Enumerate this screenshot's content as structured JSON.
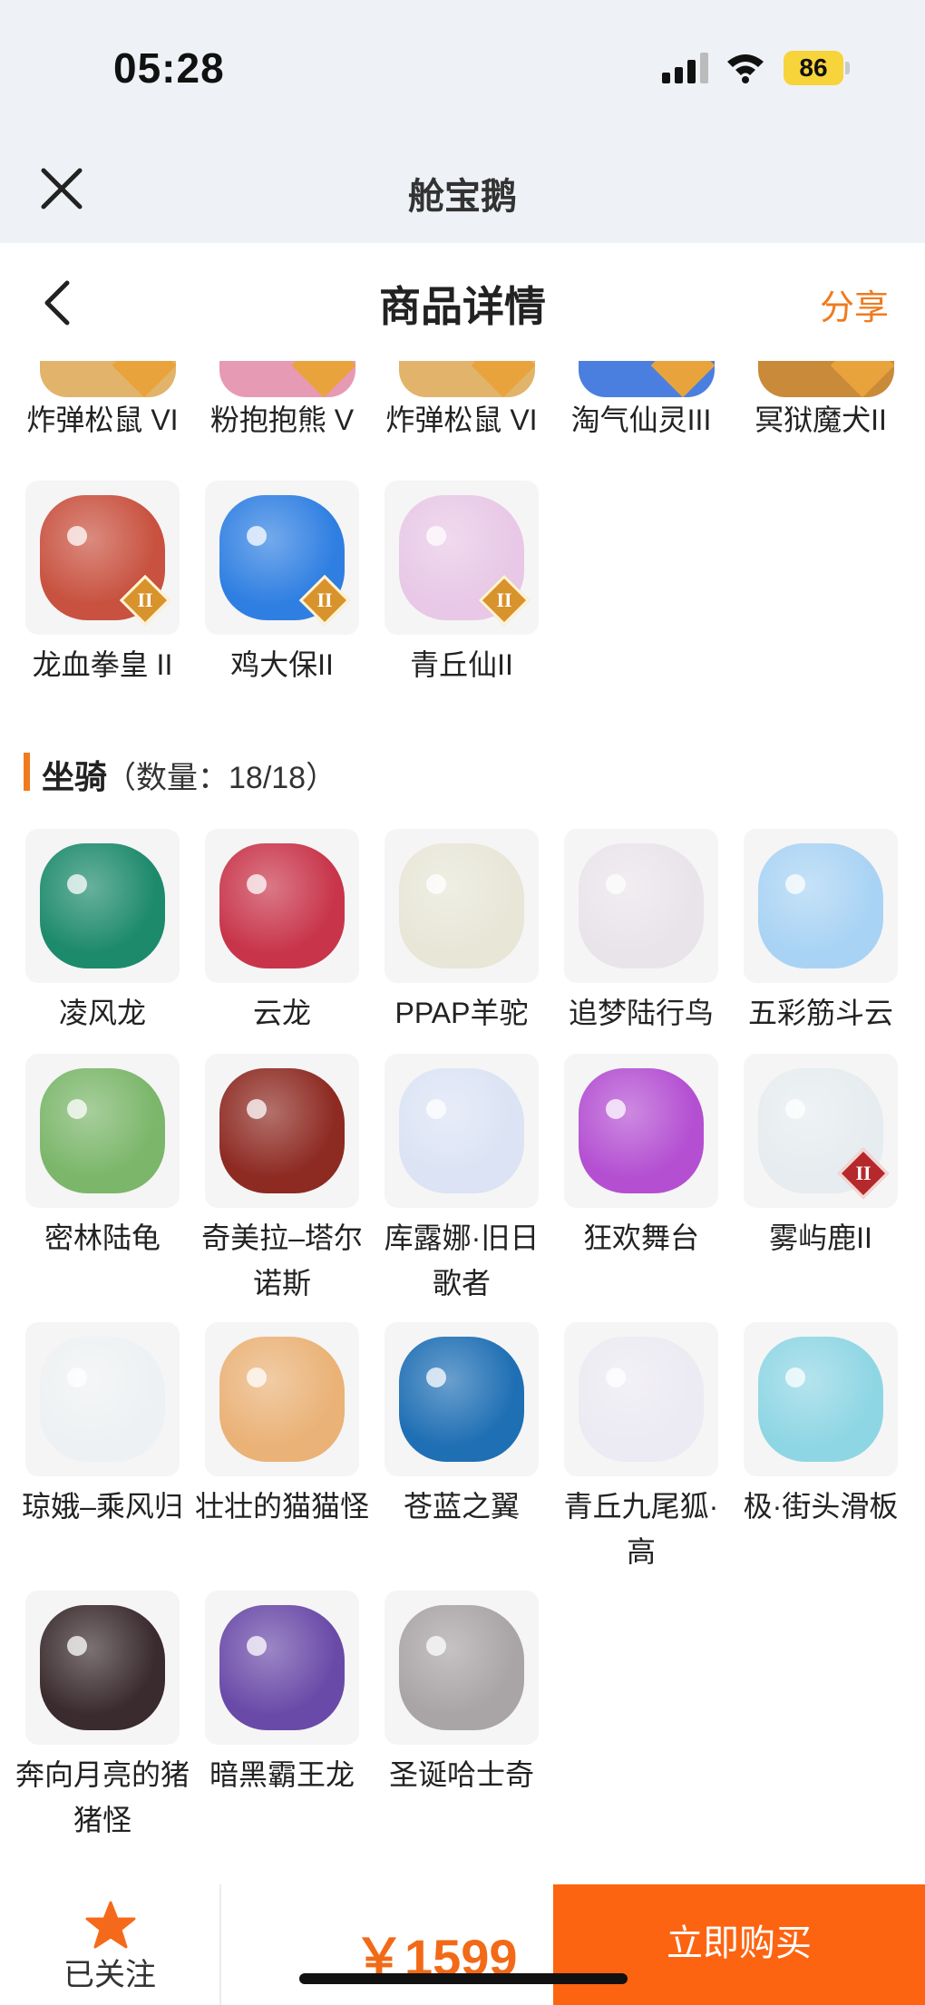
{
  "status": {
    "time": "05:28",
    "battery": "86"
  },
  "mini_program": {
    "title": "舱宝鹅"
  },
  "page": {
    "title": "商品详情",
    "share": "分享"
  },
  "cut_row": [
    {
      "label": "炸弹松鼠 VI",
      "color": "#e2b36a"
    },
    {
      "label": "粉抱抱熊 V",
      "color": "#e69ab3"
    },
    {
      "label": "炸弹松鼠 VI",
      "color": "#e2b36a"
    },
    {
      "label": "淘气仙灵III",
      "color": "#4a7fe0"
    },
    {
      "label": "冥狱魔犬II",
      "color": "#c98a3a"
    }
  ],
  "cut_grid": [
    {
      "label": "龙血拳皇 II",
      "rank": "II",
      "color": "#c8513f",
      "icon": "dragon-boxer-icon"
    },
    {
      "label": "鸡大保II",
      "rank": "II",
      "color": "#2f7fe2",
      "icon": "chicken-icon"
    },
    {
      "label": "青丘仙II",
      "rank": "II",
      "color": "#e8c8e6",
      "icon": "fox-fairy-icon"
    }
  ],
  "mounts_section": {
    "title": "坐骑",
    "count": "（数量：18/18）"
  },
  "mounts": [
    {
      "label": "凌风龙",
      "color": "#1d8a6b",
      "rank": ""
    },
    {
      "label": "云龙",
      "color": "#c8354a",
      "rank": ""
    },
    {
      "label": "PPAP羊驼",
      "color": "#e7e6d7",
      "rank": ""
    },
    {
      "label": "追梦陆行鸟",
      "color": "#e9e4ea",
      "rank": ""
    },
    {
      "label": "五彩筋斗云",
      "color": "#a9d3f4",
      "rank": ""
    },
    {
      "label": "密林陆龟",
      "color": "#7bb66a",
      "rank": ""
    },
    {
      "label": "奇美拉–塔尔诺斯",
      "color": "#8d2a22",
      "rank": ""
    },
    {
      "label": "库露娜·旧日歌者",
      "color": "#dbe3f4",
      "rank": ""
    },
    {
      "label": "狂欢舞台",
      "color": "#b44fd2",
      "rank": ""
    },
    {
      "label": "雾屿鹿II",
      "color": "#e6ecef",
      "rank": "II"
    },
    {
      "label": "琼娥–乘风归",
      "color": "#eef1f3",
      "rank": ""
    },
    {
      "label": "壮壮的猫猫怪",
      "color": "#eab277",
      "rank": ""
    },
    {
      "label": "苍蓝之翼",
      "color": "#1f6fb4",
      "rank": ""
    },
    {
      "label": "青丘九尾狐·高",
      "color": "#eceaf2",
      "rank": ""
    },
    {
      "label": "极·街头滑板",
      "color": "#8fd6e4",
      "rank": ""
    },
    {
      "label": "奔向月亮的猪猪怪",
      "color": "#3a2b2e",
      "rank": ""
    },
    {
      "label": "暗黑霸王龙",
      "color": "#6a4aa8",
      "rank": ""
    },
    {
      "label": "圣诞哈士奇",
      "color": "#a9a4a6",
      "rank": ""
    }
  ],
  "bottom": {
    "follow_label": "已关注",
    "price": "￥1599",
    "buy_label": "立即购买"
  },
  "colors": {
    "accent": "#f07a1e",
    "buy": "#fd6411",
    "price": "#f26a17"
  }
}
